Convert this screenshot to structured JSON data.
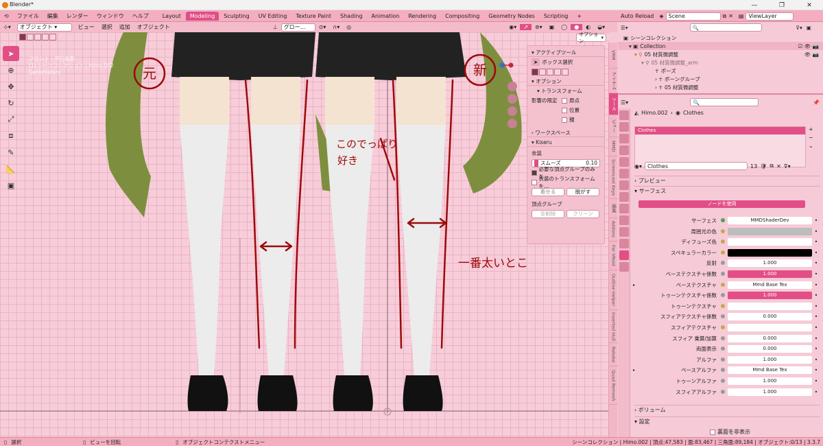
{
  "window": {
    "title": "Blender*"
  },
  "menu": {
    "items": [
      "ファイル",
      "編集",
      "レンダー",
      "ウィンドウ",
      "ヘルプ"
    ]
  },
  "workspaces": [
    "Layout",
    "Modeling",
    "Sculpting",
    "UV Editing",
    "Texture Paint",
    "Shading",
    "Animation",
    "Rendering",
    "Compositing",
    "Geometry Nodes",
    "Scripting",
    "+"
  ],
  "active_workspace": "Modeling",
  "topright": {
    "auto_reload": "Auto Reload",
    "scene": "Scene",
    "view_layer": "ViewLayer"
  },
  "viewport_header": {
    "mode": "オブジェクト",
    "items": [
      "ビュー",
      "選択",
      "追加",
      "オブジェクト"
    ],
    "transform": "グロー…",
    "options": "オプション"
  },
  "viewport_info": {
    "line1": "フロント・平行投影",
    "line2": "(1) シーンコレクション | Himo.002",
    "line3": "Centimeters"
  },
  "npanel": {
    "active_tool": "アクティブツール",
    "box_select": "ボックス選択",
    "options": "オプション",
    "transform": "トランスフォーム",
    "affect_only": "影響の限定",
    "origin": "原点",
    "location": "位置",
    "parent": "親",
    "workspace": "ワークスペース",
    "kiseru": "Kiseru",
    "clothing": "衣装",
    "smooth_label": "スムーズ",
    "smooth_value": "0.10",
    "only_needed_groups": "必要な頂点グループのみを...",
    "clothing_transform": "衣装のトランスフォームを...",
    "dress": "着せる",
    "undress": "脱がす",
    "vertex_group": "頂点グループ",
    "delete_all": "全削除",
    "clean": "クリーン"
  },
  "vtabs": [
    "VRM",
    "アイテム",
    "ツール",
    "ビュー",
    "MMD",
    "Screencast Keys",
    "編集",
    "Addons",
    "For VRoid",
    "Outline Helper",
    "Inverted Hull",
    "Rokoko",
    "Quad Remesh"
  ],
  "annotations": {
    "old": "元",
    "new": "新",
    "like": "このでっぱり\n好き",
    "thickest": "一番太いとこ"
  },
  "outliner": {
    "scene_collection": "シーンコレクション",
    "rows": [
      {
        "label": "Collection",
        "indent": 1
      },
      {
        "label": "05 材質微調整",
        "indent": 2
      },
      {
        "label": "05 材質微調整_arm",
        "indent": 3
      },
      {
        "label": "ポーズ",
        "indent": 4
      },
      {
        "label": "ボーングループ",
        "indent": 4
      },
      {
        "label": "05 材質微調整",
        "indent": 4
      }
    ]
  },
  "properties": {
    "breadcrumb_obj": "Himo.002",
    "breadcrumb_mat": "Clothes",
    "slot": "Clothes",
    "material_name": "Clothes",
    "users": "13",
    "preview": "プレビュー",
    "surface_section": "サーフェス",
    "use_nodes": "ノードを使用",
    "rows": [
      {
        "label": "サーフェス",
        "value": "MMDShaderDev",
        "style": "plain",
        "dot": "#4aa35a"
      },
      {
        "label": "周囲光の色",
        "value": "",
        "style": "gray",
        "dot": "#c8a64d"
      },
      {
        "label": "ディフューズ色",
        "value": "",
        "style": "plain",
        "dot": "#c8a64d"
      },
      {
        "label": "スペキュラーカラー",
        "value": "",
        "style": "black",
        "dot": "#c8a64d"
      },
      {
        "label": "反射",
        "value": "1.000",
        "style": "plain",
        "dot": "#999999"
      },
      {
        "label": "ベーステクスチャ係数",
        "value": "1.000",
        "style": "pink",
        "dot": "#999999"
      },
      {
        "label": "ベーステクスチャ",
        "value": "Mmd Base Tex",
        "style": "plain",
        "dot": "#c8a64d"
      },
      {
        "label": "トゥーンテクスチャ係数",
        "value": "1.000",
        "style": "pink",
        "dot": "#999999"
      },
      {
        "label": "トゥーンテクスチャ",
        "value": "",
        "style": "plain",
        "dot": "#c8a64d"
      },
      {
        "label": "スフィアテクスチャ係数",
        "value": "0.000",
        "style": "plain",
        "dot": "#999999"
      },
      {
        "label": "スフィアテクスチャ",
        "value": "",
        "style": "plain",
        "dot": "#c8a64d"
      },
      {
        "label": "スフィア 乗算/加算",
        "value": "0.000",
        "style": "plain",
        "dot": "#999999"
      },
      {
        "label": "両面表示",
        "value": "0.000",
        "style": "plain",
        "dot": "#999999"
      },
      {
        "label": "アルファ",
        "value": "1.000",
        "style": "plain",
        "dot": "#999999"
      },
      {
        "label": "ベースアルファ",
        "value": "Mmd Base Tex",
        "style": "plain",
        "dot": "#999999"
      },
      {
        "label": "トゥーンアルファ",
        "value": "1.000",
        "style": "plain",
        "dot": "#999999"
      },
      {
        "label": "スフィアアルファ",
        "value": "1.000",
        "style": "plain",
        "dot": "#999999"
      }
    ],
    "volume": "ボリューム",
    "settings": "設定",
    "hide_backface": "裏面を非表示"
  },
  "statusbar": {
    "select": "選択",
    "rotate": "ビューを回転",
    "context_menu": "オブジェクトコンテクストメニュー",
    "info": "シーンコレクション | Himo.002 | 頂点:47,583 | 面:83,467 | 三角面:89,184 | オブジェクト:0/13 | 3.3.7"
  },
  "colors": {
    "accent": "#e24e86",
    "theme_bg": "#f6c9d6",
    "annotation": "#9c0a0a"
  }
}
